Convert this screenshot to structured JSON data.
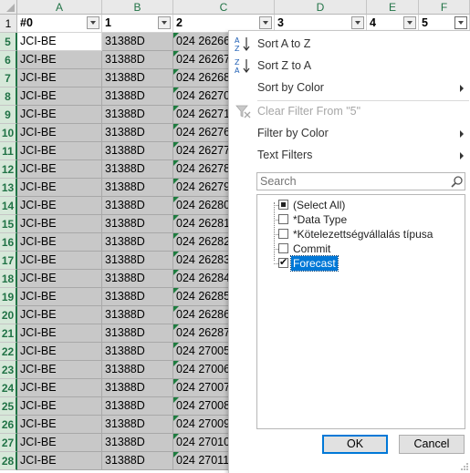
{
  "columns": [
    "A",
    "B",
    "C",
    "D",
    "E",
    "F"
  ],
  "header_row": {
    "row_num": "1",
    "cells": [
      "#0",
      "1",
      "2",
      "3",
      "4",
      "5"
    ]
  },
  "rows": [
    {
      "num": "5",
      "a": "JCI-BE",
      "b": "31388D",
      "c": "024 26266"
    },
    {
      "num": "6",
      "a": "JCI-BE",
      "b": "31388D",
      "c": "024 26267"
    },
    {
      "num": "7",
      "a": "JCI-BE",
      "b": "31388D",
      "c": "024 26268"
    },
    {
      "num": "8",
      "a": "JCI-BE",
      "b": "31388D",
      "c": "024 26270"
    },
    {
      "num": "9",
      "a": "JCI-BE",
      "b": "31388D",
      "c": "024 26271"
    },
    {
      "num": "10",
      "a": "JCI-BE",
      "b": "31388D",
      "c": "024 26276"
    },
    {
      "num": "11",
      "a": "JCI-BE",
      "b": "31388D",
      "c": "024 26277"
    },
    {
      "num": "12",
      "a": "JCI-BE",
      "b": "31388D",
      "c": "024 26278"
    },
    {
      "num": "13",
      "a": "JCI-BE",
      "b": "31388D",
      "c": "024 26279"
    },
    {
      "num": "14",
      "a": "JCI-BE",
      "b": "31388D",
      "c": "024 26280"
    },
    {
      "num": "15",
      "a": "JCI-BE",
      "b": "31388D",
      "c": "024 26281"
    },
    {
      "num": "16",
      "a": "JCI-BE",
      "b": "31388D",
      "c": "024 26282"
    },
    {
      "num": "17",
      "a": "JCI-BE",
      "b": "31388D",
      "c": "024 26283"
    },
    {
      "num": "18",
      "a": "JCI-BE",
      "b": "31388D",
      "c": "024 26284"
    },
    {
      "num": "19",
      "a": "JCI-BE",
      "b": "31388D",
      "c": "024 26285"
    },
    {
      "num": "20",
      "a": "JCI-BE",
      "b": "31388D",
      "c": "024 26286"
    },
    {
      "num": "21",
      "a": "JCI-BE",
      "b": "31388D",
      "c": "024 26287"
    },
    {
      "num": "22",
      "a": "JCI-BE",
      "b": "31388D",
      "c": "024 27005"
    },
    {
      "num": "23",
      "a": "JCI-BE",
      "b": "31388D",
      "c": "024 27006"
    },
    {
      "num": "24",
      "a": "JCI-BE",
      "b": "31388D",
      "c": "024 27007"
    },
    {
      "num": "25",
      "a": "JCI-BE",
      "b": "31388D",
      "c": "024 27008"
    },
    {
      "num": "26",
      "a": "JCI-BE",
      "b": "31388D",
      "c": "024 27009"
    },
    {
      "num": "27",
      "a": "JCI-BE",
      "b": "31388D",
      "c": "024 27010"
    },
    {
      "num": "28",
      "a": "JCI-BE",
      "b": "31388D",
      "c": "024 27011"
    }
  ],
  "filter_menu": {
    "sort_az": "Sort A to Z",
    "sort_za": "Sort Z to A",
    "sort_by_color": "Sort by Color",
    "clear_filter": "Clear Filter From \"5\"",
    "filter_by_color": "Filter by Color",
    "text_filters": "Text Filters",
    "search_placeholder": "Search",
    "items": [
      {
        "label": "(Select All)",
        "state": "mixed"
      },
      {
        "label": "*Data Type",
        "state": "unchecked"
      },
      {
        "label": "*Kötelezettségvállalás típusa",
        "state": "unchecked"
      },
      {
        "label": "Commit",
        "state": "unchecked"
      },
      {
        "label": "Forecast",
        "state": "checked"
      }
    ],
    "ok_label": "OK",
    "cancel_label": "Cancel"
  },
  "colors": {
    "accent": "#217346",
    "selection": "#0078d7",
    "filtered_fill": "#c8c8c8"
  }
}
